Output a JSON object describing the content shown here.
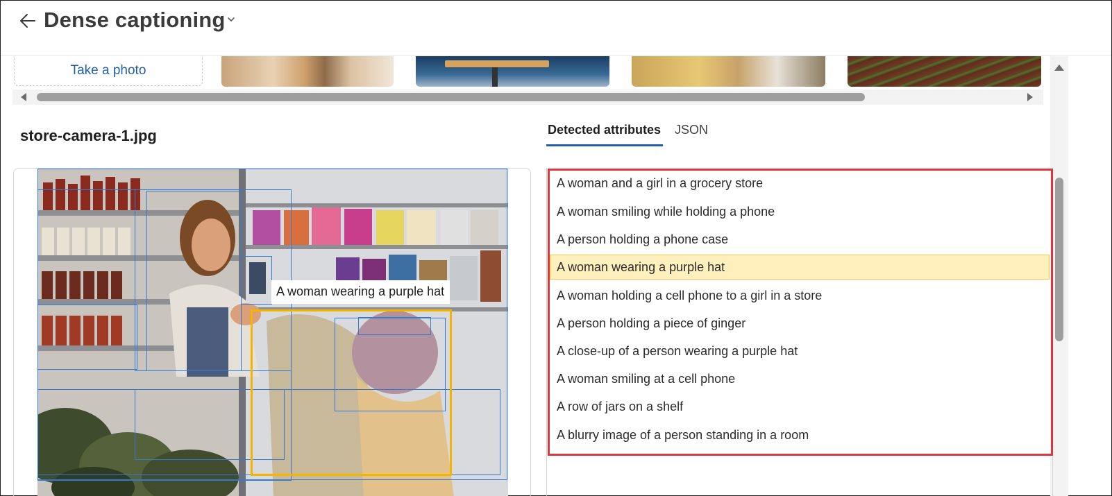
{
  "header": {
    "title": "Dense captioning"
  },
  "gallery": {
    "take_photo_label": "Take a photo",
    "thumbnails": [
      "furniture-photo",
      "office-desk-photo",
      "textile-weaving-photo",
      "crop-field-photo"
    ]
  },
  "image_panel": {
    "file_name": "store-camera-1.jpg",
    "selected_caption": "A woman wearing a purple hat"
  },
  "tabs": {
    "detected": "Detected attributes",
    "json": "JSON",
    "active": "detected"
  },
  "attributes": [
    "A woman and a girl in a grocery store",
    "A woman smiling while holding a phone",
    "A person holding a phone case",
    "A woman wearing a purple hat",
    "A woman holding a cell phone to a girl in a store",
    "A person holding a piece of ginger",
    "A close-up of a person wearing a purple hat",
    "A woman smiling at a cell phone",
    "A row of jars on a shelf",
    "A blurry image of a person standing in a room"
  ],
  "highlighted_attribute": "A woman wearing a purple hat",
  "colors": {
    "accent": "#1f5eaa",
    "bbox": "#2f7bd6",
    "selected_bbox": "#f4b400",
    "highlight_bg": "#fff0bd",
    "outline": "#e2363c"
  }
}
